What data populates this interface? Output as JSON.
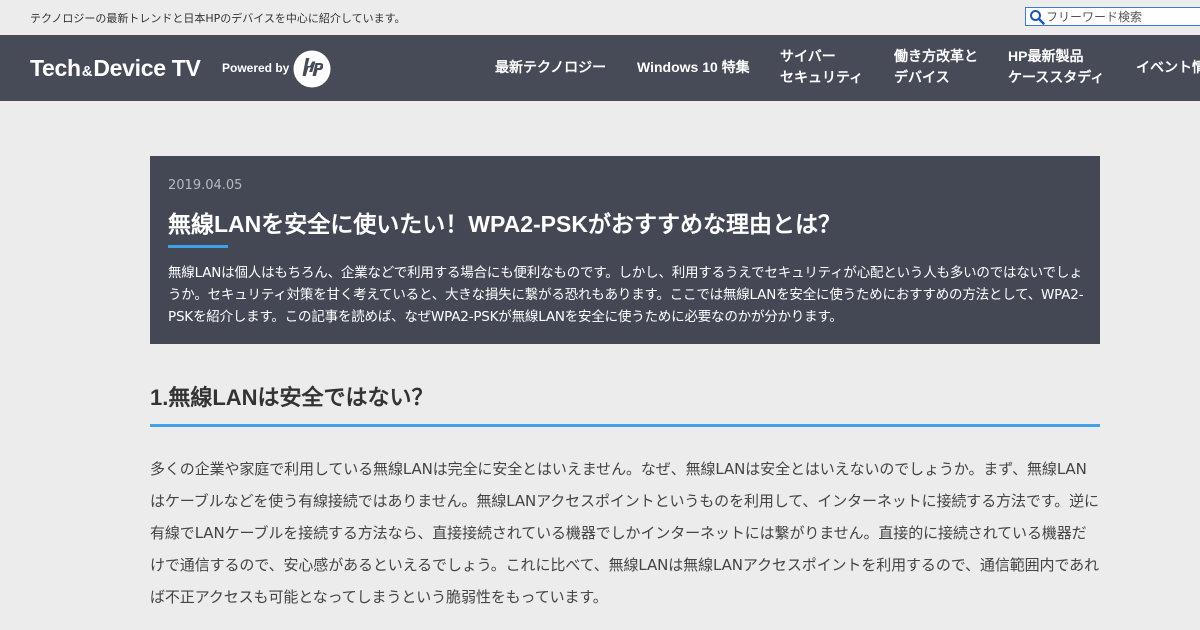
{
  "topbar": {
    "tagline": "テクノロジーの最新トレンドと日本HPのデバイスを中心に紹介しています。",
    "search_placeholder": "フリーワード検索"
  },
  "header": {
    "logo_part1": "Tech",
    "logo_amp": "&",
    "logo_part2": "Device TV",
    "powered_by": "Powered by",
    "hp_logo_icon": "hp-logo-icon",
    "nav": [
      {
        "line1": "最新テクノロジー",
        "line2": ""
      },
      {
        "line1": "Windows 10 特集",
        "line2": ""
      },
      {
        "line1": "サイバー",
        "line2": "セキュリティ"
      },
      {
        "line1": "働き方改革と",
        "line2": "デバイス"
      },
      {
        "line1": "HP最新製品",
        "line2": "ケーススタディ"
      },
      {
        "line1": "イベント情",
        "line2": ""
      }
    ]
  },
  "article": {
    "date": "2019.04.05",
    "title": "無線LANを安全に使いたい！WPA2-PSKがおすすめな理由とは？",
    "lead": "無線LANは個人はもちろん、企業などで利用する場合にも便利なものです。しかし、利用するうえでセキュリティが心配という人も多いのではないでしょうか。セキュリティ対策を甘く考えていると、大きな損失に繋がる恐れもあります。ここでは無線LANを安全に使うためにおすすめの方法として、WPA2-PSKを紹介します。この記事を読めば、なぜWPA2-PSKが無線LANを安全に使うために必要なのかが分かります。",
    "section_heading": "1.無線LANは安全ではない？",
    "section_body": "多くの企業や家庭で利用している無線LANは完全に安全とはいえません。なぜ、無線LANは安全とはいえないのでしょうか。まず、無線LANはケーブルなどを使う有線接続ではありません。無線LANアクセスポイントというものを利用して、インターネットに接続する方法です。逆に有線でLANケーブルを接続する方法なら、直接接続されている機器でしかインターネットには繋がりません。直接的に接続されている機器だけで通信するので、安心感があるといえるでしょう。これに比べて、無線LANは無線LANアクセスポイントを利用するので、通信範囲内であれば不正アクセスも可能となってしまうという脆弱性をもっています。"
  },
  "colors": {
    "header_bg": "#474b57",
    "hero_bg": "#434854",
    "accent": "#3fa2e8",
    "page_bg": "#ececec"
  }
}
